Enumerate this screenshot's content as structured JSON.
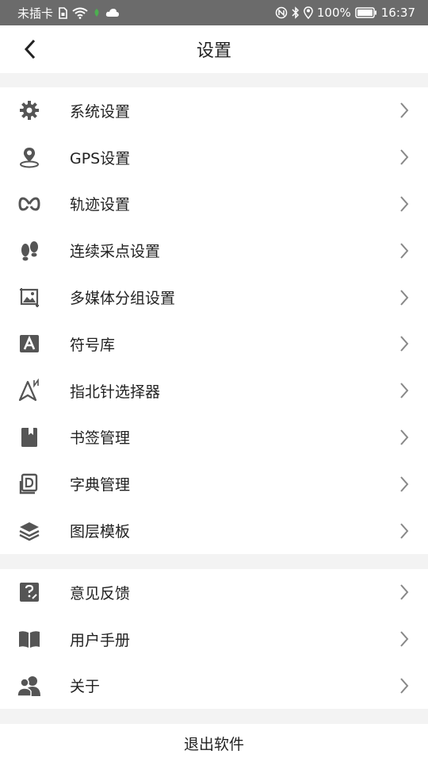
{
  "status_bar": {
    "carrier": "未插卡",
    "battery": "100%",
    "time": "16:37"
  },
  "header": {
    "title": "设置"
  },
  "menu_group_1": [
    {
      "label": "系统设置",
      "icon": "gear-icon"
    },
    {
      "label": "GPS设置",
      "icon": "location-pin-icon"
    },
    {
      "label": "轨迹设置",
      "icon": "track-loop-icon"
    },
    {
      "label": "连续采点设置",
      "icon": "footprints-icon"
    },
    {
      "label": "多媒体分组设置",
      "icon": "media-image-icon"
    },
    {
      "label": "符号库",
      "icon": "symbol-letter-icon"
    },
    {
      "label": "指北针选择器",
      "icon": "north-arrow-icon"
    },
    {
      "label": "书签管理",
      "icon": "bookmark-icon"
    },
    {
      "label": "字典管理",
      "icon": "dictionary-icon"
    },
    {
      "label": "图层模板",
      "icon": "layers-icon"
    }
  ],
  "menu_group_2": [
    {
      "label": "意见反馈",
      "icon": "feedback-icon"
    },
    {
      "label": "用户手册",
      "icon": "book-icon"
    },
    {
      "label": "关于",
      "icon": "about-users-icon"
    }
  ],
  "logout": {
    "label": "退出软件"
  }
}
